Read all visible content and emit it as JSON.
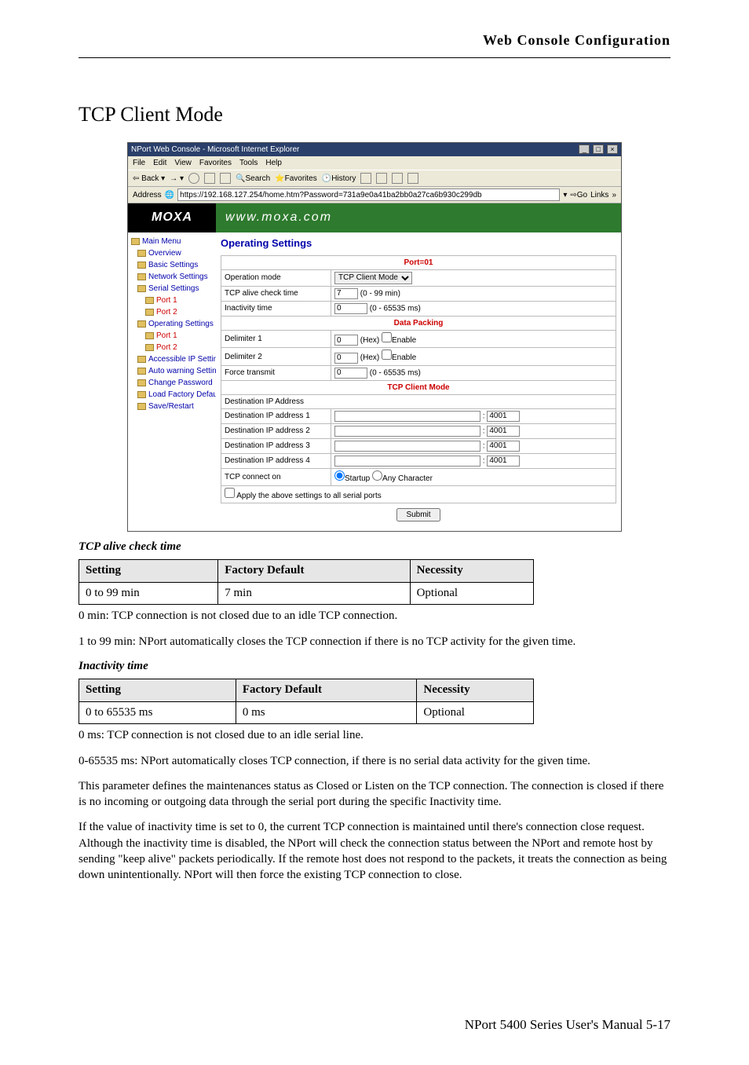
{
  "header_title": "Web Console Configuration",
  "main_heading": "TCP Client Mode",
  "window": {
    "title": "NPort Web Console - Microsoft Internet Explorer",
    "menus": [
      "File",
      "Edit",
      "View",
      "Favorites",
      "Tools",
      "Help"
    ],
    "toolbar": {
      "back": "Back",
      "search": "Search",
      "favorites": "Favorites",
      "history": "History"
    },
    "address_label": "Address",
    "address_value": "https://192.168.127.254/home.htm?Password=731a9e0a41ba2bb0a27ca6b930c299db",
    "go": "Go",
    "links": "Links"
  },
  "brand": {
    "logo": "MOXA",
    "url": "www.moxa.com"
  },
  "nav": {
    "main": "Main Menu",
    "overview": "Overview",
    "basic": "Basic Settings",
    "network": "Network Settings",
    "serial": "Serial Settings",
    "port1": "Port 1",
    "port2": "Port 2",
    "operating": "Operating Settings",
    "op_port1": "Port 1",
    "op_port2": "Port 2",
    "accessible": "Accessible IP Settings",
    "autowarn": "Auto warning Settings",
    "changepw": "Change Password",
    "loadfactory": "Load Factory Default",
    "saverestart": "Save/Restart"
  },
  "pane": {
    "title": "Operating Settings",
    "port_header": "Port=01",
    "op_mode_label": "Operation mode",
    "op_mode_value": "TCP Client Mode",
    "tcp_alive_label": "TCP alive check time",
    "tcp_alive_value": "7",
    "tcp_alive_hint": "(0 - 99 min)",
    "inactivity_label": "Inactivity time",
    "inactivity_value": "0",
    "inactivity_hint": "(0 - 65535 ms)",
    "data_packing": "Data Packing",
    "delim1_label": "Delimiter 1",
    "delim1_value": "0",
    "delim_hint": "(Hex)",
    "enable": "Enable",
    "delim2_label": "Delimiter 2",
    "delim2_value": "0",
    "force_label": "Force transmit",
    "force_value": "0",
    "force_hint": "(0 - 65535 ms)",
    "client_mode_hdr": "TCP Client Mode",
    "dest_ip_hdr": "Destination IP Address",
    "dest1": "Destination IP address 1",
    "dest2": "Destination IP address 2",
    "dest3": "Destination IP address 3",
    "dest4": "Destination IP address 4",
    "port_default": "4001",
    "tcp_connect_label": "TCP connect on",
    "startup": "Startup",
    "anychar": "Any Character",
    "apply_all": "Apply the above settings to all serial ports",
    "submit": "Submit"
  },
  "section1": {
    "title": "TCP alive check time",
    "th1": "Setting",
    "th2": "Factory Default",
    "th3": "Necessity",
    "td1": "0 to 99 min",
    "td2": "7 min",
    "td3": "Optional",
    "p1": "0 min: TCP connection is not closed due to an idle TCP connection.",
    "p2": "1 to 99 min: NPort automatically closes the TCP connection if there is no TCP activity for the given time."
  },
  "section2": {
    "title": "Inactivity time",
    "th1": "Setting",
    "th2": "Factory Default",
    "th3": "Necessity",
    "td1": "0 to 65535 ms",
    "td2": "0 ms",
    "td3": "Optional",
    "p1": "0 ms: TCP connection is not closed due to an idle serial line.",
    "p2": "0-65535 ms: NPort automatically closes TCP connection, if there is no serial data activity for the given time.",
    "p3": "This parameter defines the maintenances status as Closed or Listen on the TCP connection. The connection is closed if there is no incoming or outgoing data through the serial port during the specific Inactivity time.",
    "p4": "If the value of inactivity time is set to 0, the current TCP connection is maintained until there's connection close request. Although the inactivity time is disabled, the NPort will check the connection status between the NPort and remote host by sending \"keep alive\" packets periodically. If the remote host does not respond to the packets, it treats the connection as being down unintentionally. NPort will then force the existing TCP connection to close."
  },
  "footer": "NPort 5400 Series User's Manual  5-17"
}
